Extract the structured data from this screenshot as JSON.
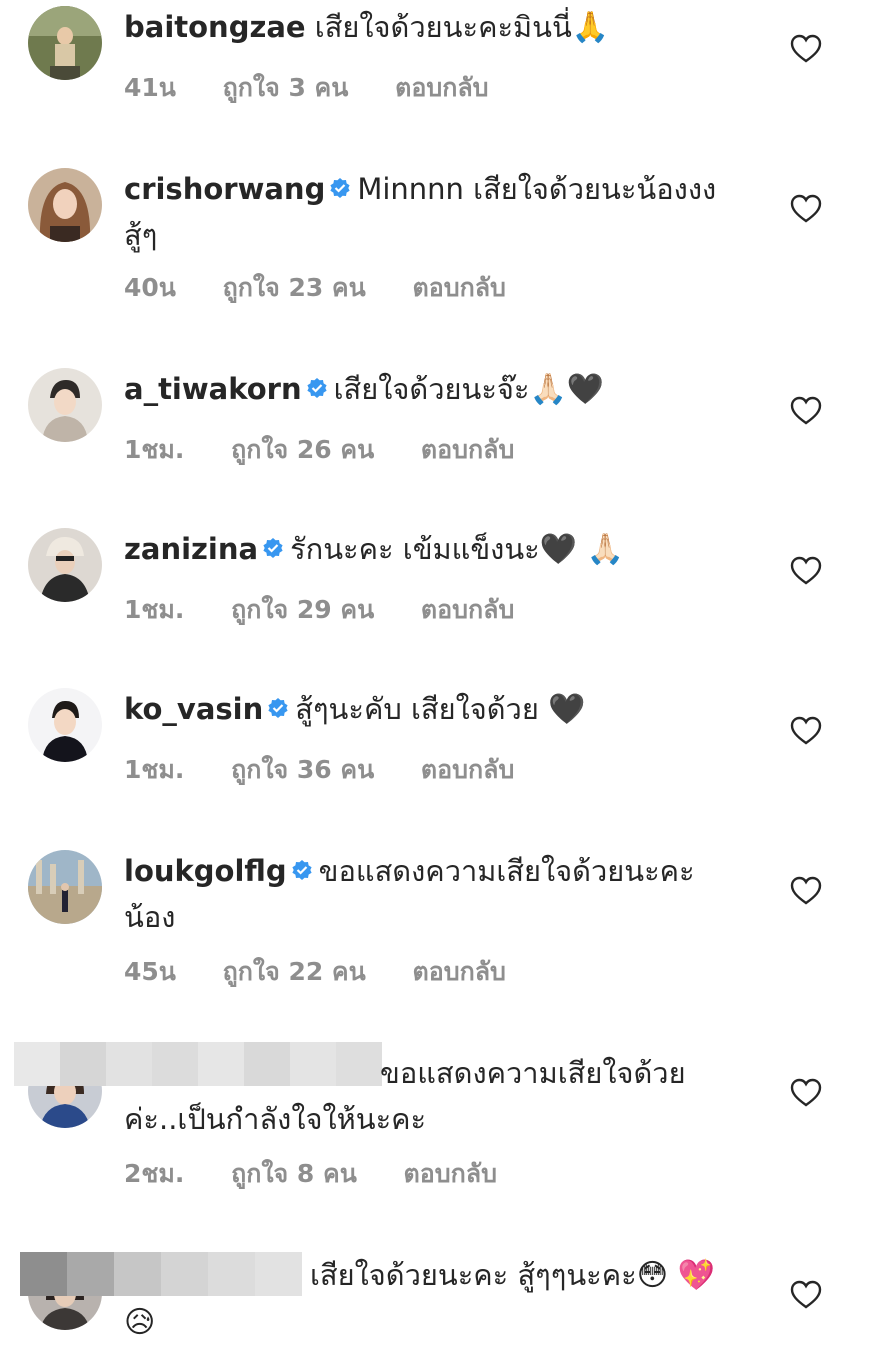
{
  "comments": [
    {
      "username": "baitongzae",
      "verified": false,
      "text": "เสียใจด้วยนะคะมินนี่",
      "emoji": "🙏",
      "time": "41น",
      "likes": "ถูกใจ 3 คน",
      "reply": "ตอบกลับ"
    },
    {
      "username": "crishorwang",
      "verified": true,
      "text": "Minnnn เสียใจด้วยนะน้องงง สู้ๆ",
      "emoji": "",
      "time": "40น",
      "likes": "ถูกใจ 23 คน",
      "reply": "ตอบกลับ"
    },
    {
      "username": "a_tiwakorn",
      "verified": true,
      "text": "เสียใจด้วยนะจ๊ะ",
      "emoji": "🙏🏻🖤",
      "time": "1ชม.",
      "likes": "ถูกใจ 26 คน",
      "reply": "ตอบกลับ"
    },
    {
      "username": "zanizina",
      "verified": true,
      "text": "รักนะคะ เข้มแข็งนะ",
      "emoji": "🖤 🙏🏻",
      "time": "1ชม.",
      "likes": "ถูกใจ 29 คน",
      "reply": "ตอบกลับ"
    },
    {
      "username": "ko_vasin",
      "verified": true,
      "text": "สู้ๆนะคับ เสียใจด้วย",
      "emoji": "🖤",
      "time": "1ชม.",
      "likes": "ถูกใจ 36 คน",
      "reply": "ตอบกลับ"
    },
    {
      "username": "loukgolflg",
      "verified": true,
      "text": "ขอแสดงความเสียใจด้วยนะคะ น้อง",
      "emoji": "",
      "time": "45น",
      "likes": "ถูกใจ 22 คน",
      "reply": "ตอบกลับ"
    },
    {
      "username": "",
      "verified": false,
      "text": "ขอแสดงความเสียใจด้วย ค่ะ..เป็นกำลังใจให้นะคะ",
      "emoji": "",
      "time": "2ชม.",
      "likes": "ถูกใจ 8 คน",
      "reply": "ตอบกลับ"
    },
    {
      "username": "",
      "verified": false,
      "text": "เสียใจด้วยนะคะ สู้ๆๆนะคะ",
      "emoji": "😳 💖 😥",
      "time": "",
      "likes": "",
      "reply": ""
    }
  ],
  "colors": {
    "verified": "#3897f0",
    "meta": "#8e8e8e",
    "text": "#262626",
    "heart": "#262626"
  },
  "icons": {
    "like": "heart-outline-icon",
    "verified": "verified-badge-icon"
  }
}
